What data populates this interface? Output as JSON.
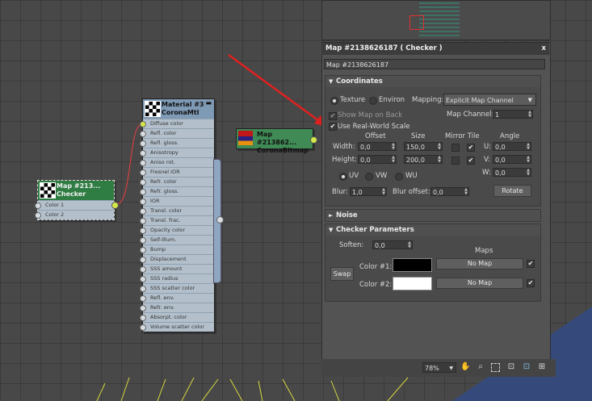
{
  "map_node": {
    "title": "Map #213...",
    "type": "Checker",
    "slots": [
      "Color 1",
      "Color 2"
    ]
  },
  "material_node": {
    "title": "Material #3",
    "type": "CoronaMtl",
    "slots": [
      "Diffuse color",
      "Refl. color",
      "Refl. gloss.",
      "Anisotropy",
      "Aniso rot.",
      "Fresnel IOR",
      "Refr. color",
      "Refr. gloss.",
      "IOR",
      "Transl. color",
      "Transl. frac.",
      "Opacity color",
      "Self-Illum.",
      "Bump",
      "Displacement",
      "SSS amount",
      "SSS radius",
      "SSS scatter color",
      "Refl. env.",
      "Refr. env.",
      "Absorpt. color",
      "Volume scatter color"
    ]
  },
  "bitmap_node": {
    "title": "Map #213862...",
    "type": "CoronaBitmap"
  },
  "panel": {
    "title": "Map #2138626187  ( Checker )",
    "close": "x",
    "name_value": "Map #2138626187",
    "coordinates": {
      "header": "Coordinates",
      "texture_label": "Texture",
      "environ_label": "Environ",
      "mapping_label": "Mapping:",
      "mapping_value": "Explicit Map Channel",
      "show_map_label": "Show Map on Back",
      "map_channel_label": "Map Channel:",
      "map_channel_value": "1",
      "real_world_label": "Use Real-World Scale",
      "col_offset": "Offset",
      "col_size": "Size",
      "col_mirror_tile": "Mirror Tile",
      "col_angle": "Angle",
      "width_label": "Width:",
      "width_offset": "0,0",
      "width_size": "150,0",
      "height_label": "Height:",
      "height_offset": "0,0",
      "height_size": "200,0",
      "u_label": "U:",
      "u_value": "0,0",
      "v_label": "V:",
      "v_value": "0,0",
      "w_label": "W:",
      "w_value": "0,0",
      "uv_label": "UV",
      "vw_label": "VW",
      "wu_label": "WU",
      "blur_label": "Blur:",
      "blur_value": "1,0",
      "blur_offset_label": "Blur offset:",
      "blur_offset_value": "0,0",
      "rotate_label": "Rotate"
    },
    "noise": {
      "header": "Noise"
    },
    "checker": {
      "header": "Checker Parameters",
      "soften_label": "Soften:",
      "soften_value": "0,0",
      "maps_label": "Maps",
      "swap_label": "Swap",
      "color1_label": "Color #1:",
      "color1": "#000000",
      "color1_map": "No Map",
      "color2_label": "Color #2:",
      "color2": "#ffffff",
      "color2_map": "No Map"
    }
  },
  "bottom_bar": {
    "zoom": "78%"
  },
  "colors": {
    "arrow": "#e02020",
    "wire": "#d04040",
    "node_green": "#3f8a55",
    "header_blue": "#7f9ab5"
  }
}
